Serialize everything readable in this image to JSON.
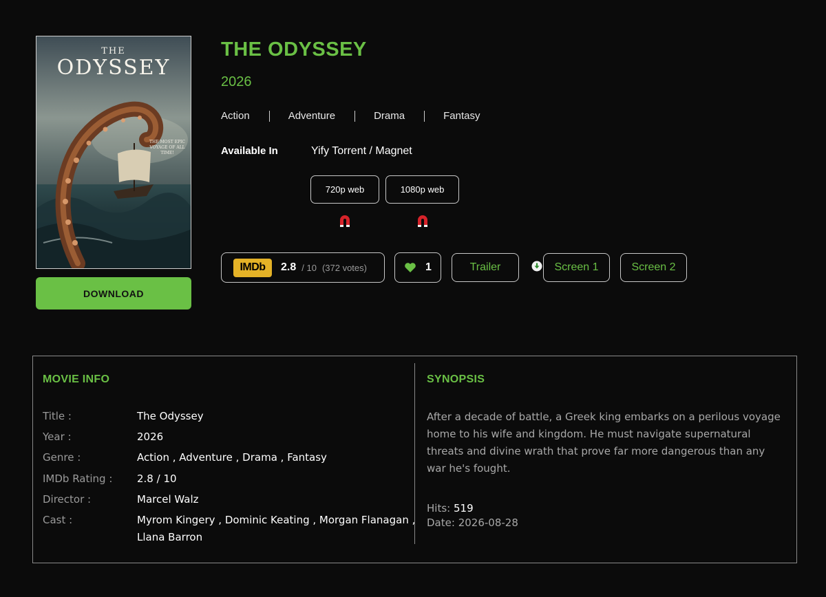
{
  "movie": {
    "title": "THE ODYSSEY",
    "year": "2026",
    "genres": [
      "Action",
      "Adventure",
      "Drama",
      "Fantasy"
    ],
    "poster": {
      "title_small": "THE",
      "title_big": "ODYSSEY",
      "tagline": "THE MOST EPIC VOYAGE OF ALL TIME!"
    },
    "download_label": "DOWNLOAD"
  },
  "availability": {
    "label": "Available In",
    "source": "Yify Torrent / Magnet",
    "qualities": [
      {
        "label": "720p web",
        "icon": "magnet-icon"
      },
      {
        "label": "1080p web",
        "icon": "magnet-icon"
      }
    ]
  },
  "actions": {
    "imdb_logo": "IMDb",
    "imdb_rating": "2.8",
    "imdb_scale": "/ 10",
    "imdb_votes": "(372 votes)",
    "likes": "1",
    "trailer_label": "Trailer",
    "screen1_label": "Screen 1",
    "screen2_label": "Screen 2"
  },
  "movie_info": {
    "heading": "MOVIE INFO",
    "rows": [
      {
        "key": "Title :",
        "value": "The Odyssey"
      },
      {
        "key": "Year :",
        "value": "2026"
      },
      {
        "key": "Genre :",
        "value": "Action , Adventure , Drama , Fantasy"
      },
      {
        "key": "IMDb Rating :",
        "value": "2.8 / 10"
      },
      {
        "key": "Director :",
        "value": "Marcel Walz"
      },
      {
        "key": "Cast :",
        "value": "Myrom Kingery , Dominic Keating , Morgan Flanagan ,",
        "value2": "Llana Barron"
      }
    ]
  },
  "synopsis": {
    "heading": "SYNOPSIS",
    "text": "After a decade of battle, a Greek king embarks on a perilous voyage home to his wife and kingdom. He must navigate supernatural threats and divine wrath that prove far more dangerous than any war he's fought.",
    "hits_label": "Hits:",
    "hits_value": "519",
    "date_label": "Date:",
    "date_value": "2026-08-28"
  },
  "colors": {
    "accent": "#6ac045",
    "background": "#0b0b0b",
    "imdb_yellow": "#e4b227",
    "magnet_red": "#d6232a"
  }
}
